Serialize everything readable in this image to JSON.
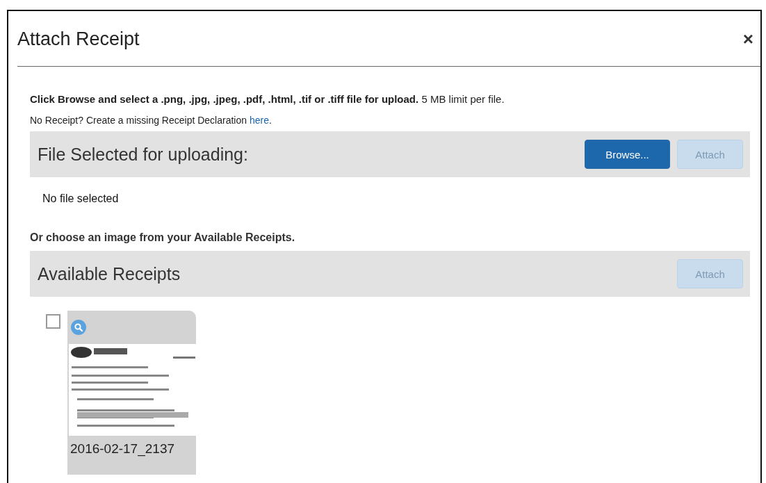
{
  "dialog": {
    "title": "Attach Receipt",
    "close": "×"
  },
  "instructions": {
    "main": "**Click Browse and select a .png, .jpg, .jpeg, .pdf, .html, .tif or .tiff file for upload.** 5 MB limit per file.",
    "declaration": "No Receipt? Create a missing Receipt Declaration ",
    "link": "here",
    "after_link": "."
  },
  "upload": {
    "heading": "File Selected for uploading:",
    "buttons": [
      {
        "label": "Browse...",
        "disabled": false
      },
      {
        "label": "Attach",
        "disabled": true
      }
    ],
    "status": "No file selected"
  },
  "choose_prompt": "Or choose an image from your Available Receipts.",
  "available": {
    "heading": "Available Receipts",
    "buttons": [
      {
        "label": "Attach",
        "disabled": true
      }
    ],
    "receipts": [
      {
        "checked": false,
        "filename": "2016-02-17_2137"
      }
    ]
  }
}
